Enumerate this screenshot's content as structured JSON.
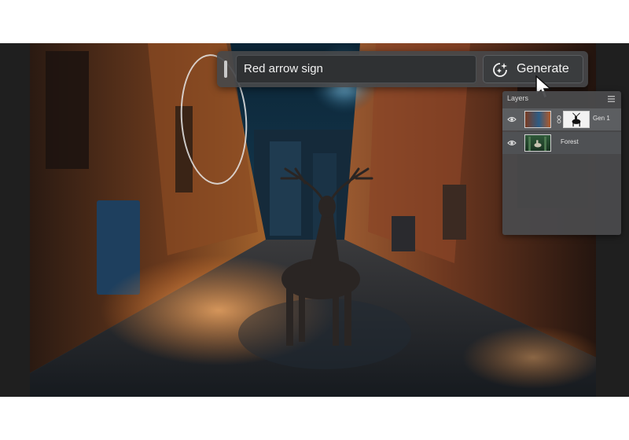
{
  "prompt": {
    "input_value": "Red arrow sign",
    "generate_label": "Generate"
  },
  "layers_panel": {
    "title": "Layers",
    "layers": [
      {
        "name": "Gen 1",
        "visible": true,
        "has_mask": true
      },
      {
        "name": "Forest",
        "visible": true,
        "has_mask": false
      }
    ]
  },
  "icons": {
    "generate": "sparkle-refresh-icon",
    "layer_visibility": "eye-icon",
    "panel_menu": "hamburger-menu-icon",
    "cursor": "pointer-cursor-icon",
    "mask_link": "chain-link-icon"
  },
  "colors": {
    "panel_bg": "#4a4a4c",
    "selected_layer": "#5c5e61",
    "prompt_bg": "#46484a",
    "input_bg": "#2f3133"
  }
}
